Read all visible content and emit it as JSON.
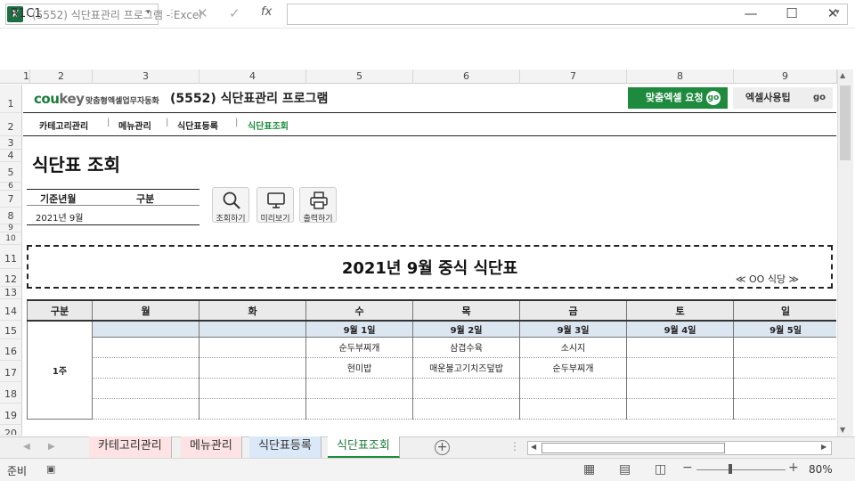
{
  "window": {
    "title": "(5552) 식단표관리 프로그램  -  Excel",
    "app_icon": "X",
    "controls": {
      "minimize": "—",
      "maximize": "☐",
      "close": "✕"
    }
  },
  "formula_bar": {
    "name_box": "R1C1",
    "cancel": "✕",
    "enter": "✓",
    "fx": "fx",
    "formula": ""
  },
  "columns": [
    "1",
    "2",
    "3",
    "4",
    "5",
    "6",
    "7",
    "8",
    "9"
  ],
  "rows": [
    "1",
    "2",
    "3",
    "4",
    "5",
    "6",
    "7",
    "8",
    "9",
    "10",
    "11",
    "12",
    "13",
    "14",
    "15",
    "16",
    "17",
    "18",
    "19",
    "20"
  ],
  "header": {
    "logo_main": "cou",
    "logo_key": "key",
    "tagline": "맞춤형엑셀업무자동화",
    "title": "(5552) 식단표관리 프로그램",
    "btn_custom": "맞춤엑셀 요청",
    "btn_tips": "엑셀사용팁",
    "go": "go"
  },
  "nav": [
    "카테고리관리",
    "메뉴관리",
    "식단표등록",
    "식단표조회"
  ],
  "nav_sep": "|",
  "page": {
    "title": "식단표 조회",
    "filter_month_label": "기준년월",
    "filter_div_label": "구분",
    "filter_month_value": "2021년 9월",
    "btn_search": "조회하기",
    "btn_preview": "미리보기",
    "btn_print": "출력하기"
  },
  "menu": {
    "title": "2021년 9월 중식 식단표",
    "restaurant": "≪ OO 식당 ≫",
    "header": [
      "구분",
      "월",
      "화",
      "수",
      "목",
      "금",
      "토",
      "일"
    ],
    "dates": [
      "",
      "",
      "9월 1일",
      "9월 2일",
      "9월 3일",
      "9월 4일",
      "9월 5일"
    ],
    "week": "1주",
    "rows": [
      [
        "",
        "",
        "순두부찌개",
        "삼겹수육",
        "소시지",
        "",
        ""
      ],
      [
        "",
        "",
        "현미밥",
        "매운불고기치즈덮밥",
        "순두부찌개",
        "",
        ""
      ],
      [
        "",
        "",
        "",
        "",
        "",
        "",
        ""
      ],
      [
        "",
        "",
        "",
        "",
        "",
        "",
        ""
      ]
    ]
  },
  "tabs": [
    "카테고리관리",
    "메뉴관리",
    "식단표등록",
    "식단표조회"
  ],
  "tab_colors": [
    "#fde3e3",
    "#fde3e3",
    "#dbe8f7",
    "#ffffff"
  ],
  "active_tab": "식단표조회",
  "status": {
    "ready": "준비",
    "zoom": "80%",
    "minus": "−",
    "plus": "+"
  }
}
